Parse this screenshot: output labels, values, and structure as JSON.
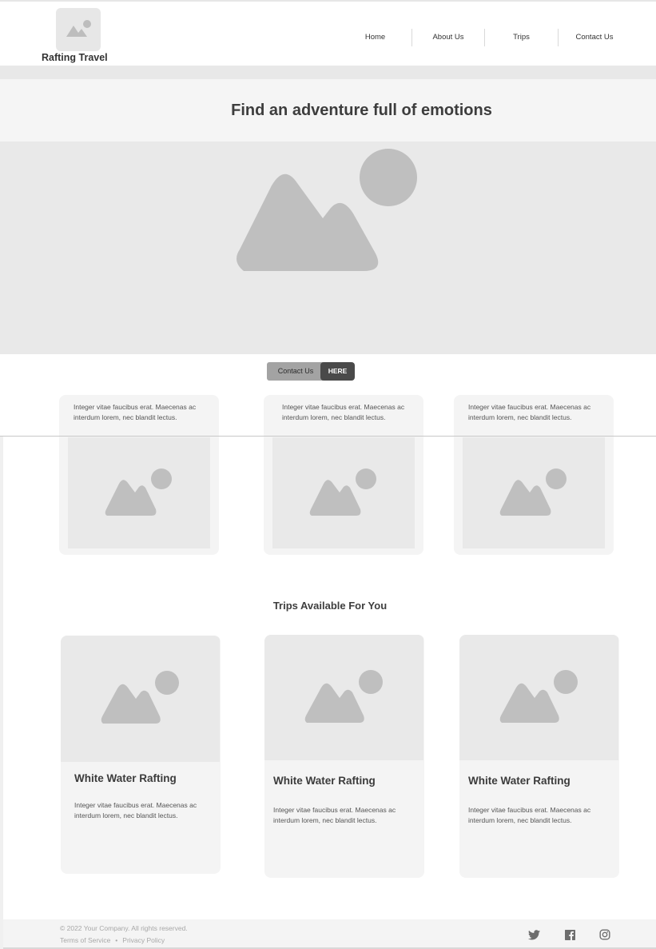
{
  "header": {
    "logo_text": "Rafting Travel",
    "nav": [
      {
        "label": "Home"
      },
      {
        "label": "About Us"
      },
      {
        "label": "Trips"
      },
      {
        "label": "Contact Us"
      }
    ]
  },
  "hero": {
    "title": "Find an adventure full of emotions"
  },
  "cta": {
    "label": "Contact Us",
    "badge": "HERE"
  },
  "features": [
    {
      "text": "Integer vitae faucibus erat. Maecenas ac interdum lorem, nec blandit lectus."
    },
    {
      "text": "Integer vitae faucibus erat. Maecenas ac interdum lorem, nec blandit lectus."
    },
    {
      "text": "Integer vitae faucibus erat. Maecenas ac interdum lorem, nec blandit lectus."
    }
  ],
  "trips": {
    "section_title": "Trips Available For You",
    "items": [
      {
        "title": "White Water Rafting",
        "text": "Integer vitae faucibus erat. Maecenas ac interdum lorem, nec blandit lectus."
      },
      {
        "title": "White Water Rafting",
        "text": "Integer vitae faucibus erat. Maecenas ac interdum lorem, nec blandit lectus."
      },
      {
        "title": "White Water Rafting",
        "text": "Integer vitae faucibus erat. Maecenas ac interdum lorem, nec blandit lectus."
      }
    ]
  },
  "footer": {
    "copyright": "© 2022 Your Company.  All rights reserved.",
    "links": [
      {
        "label": "Terms of Service"
      },
      {
        "label": "Privacy Policy"
      }
    ],
    "separator": "•",
    "social": [
      {
        "icon": "twitter-icon"
      },
      {
        "icon": "facebook-icon"
      },
      {
        "icon": "instagram-icon"
      }
    ]
  },
  "colors": {
    "placeholder_bg": "#e9e9e9",
    "placeholder_shape": "#bfbfbf",
    "card_bg": "#f4f4f4",
    "cta_badge": "#4a4a4a"
  }
}
